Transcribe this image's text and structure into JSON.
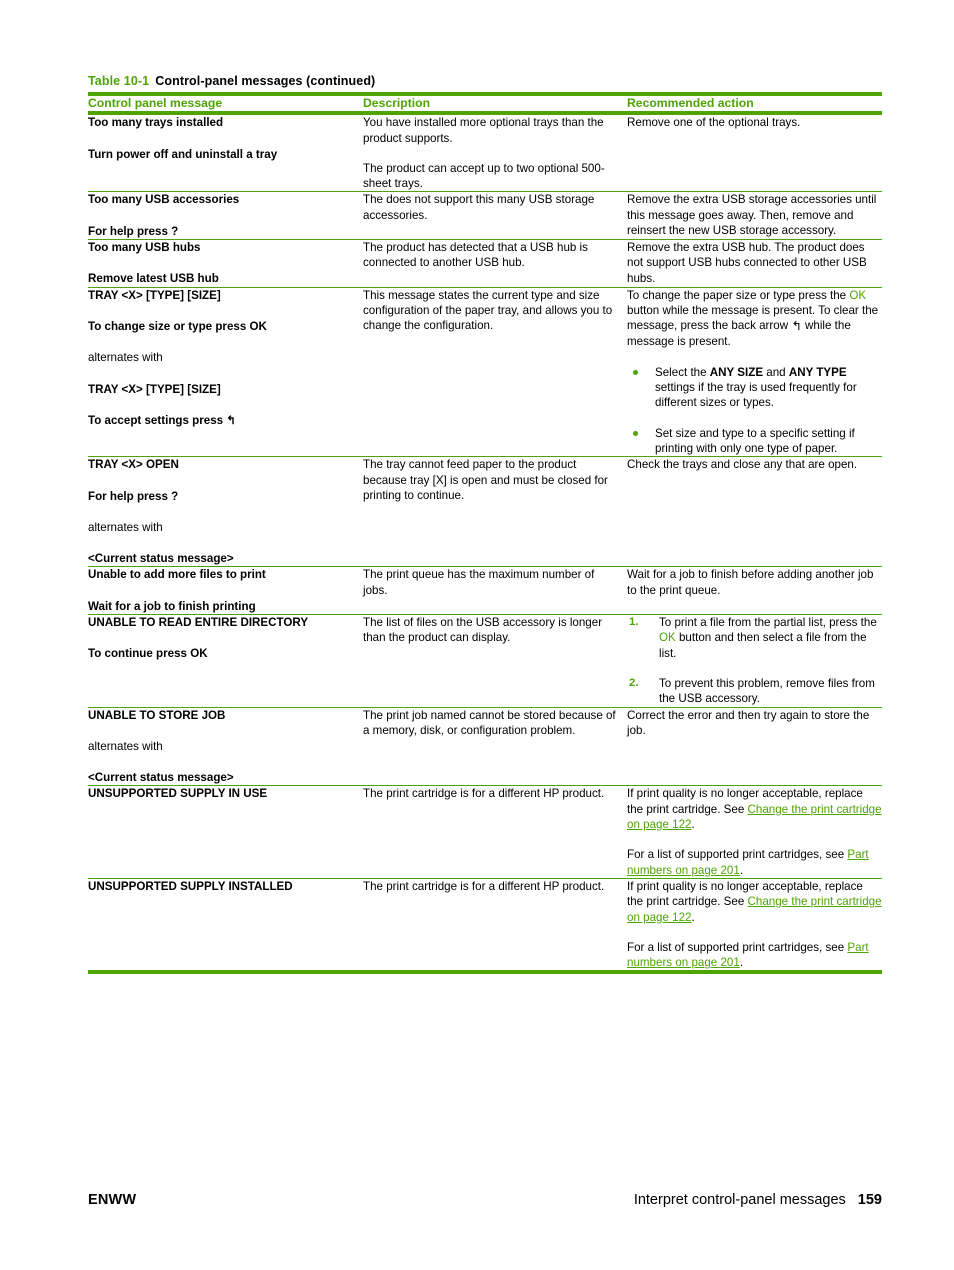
{
  "table": {
    "caption_number": "Table 10-1",
    "caption_title": "Control-panel messages (continued)",
    "headers": {
      "col1": "Control panel message",
      "col2": "Description",
      "col3": "Recommended action"
    },
    "accent_color": "#4ea305",
    "rows": [
      {
        "message_lines": [
          "Too many trays installed",
          "Turn power off and uninstall a tray"
        ],
        "description_paras": [
          "You have installed more optional trays than the product supports.",
          "The product can accept up to two optional 500-sheet trays."
        ],
        "action_paras": [
          "Remove one of the optional trays."
        ]
      },
      {
        "message_lines": [
          "Too many USB accessories",
          "For help press ?"
        ],
        "description_paras": [
          "The does not support this many USB storage accessories."
        ],
        "action_paras": [
          "Remove the extra USB storage accessories until this message goes away. Then, remove and reinsert the new USB storage accessory."
        ]
      },
      {
        "message_lines": [
          "Too many USB hubs",
          "Remove latest USB hub"
        ],
        "description_paras": [
          "The product has detected that a USB hub is connected to another USB hub."
        ],
        "action_paras": [
          "Remove the extra USB hub. The product does not support USB hubs connected to other USB hubs."
        ]
      },
      {
        "message_lines": [
          "TRAY <X> [TYPE] [SIZE]",
          "To change size or type press OK",
          "alternates with",
          "TRAY <X> [TYPE] [SIZE]",
          "To accept settings press ↰"
        ],
        "alternates_label": "alternates with",
        "description_paras": [
          "This message states the current type and size configuration of the paper tray, and allows you to change the configuration."
        ],
        "action_intro_a": "To change the paper size or type press the ",
        "action_ok": "OK",
        "action_intro_b": " button while the message is present. To clear the message, press the back arrow ",
        "action_arrow": "↰",
        "action_intro_c": " while the message is present.",
        "bullets": [
          {
            "a": "Select the ",
            "b1": "ANY SIZE",
            "c": " and ",
            "b2": "ANY TYPE",
            "d": " settings if the tray is used frequently for different sizes or types."
          },
          {
            "a": "Set size and type to a specific setting if printing with only one type of paper.",
            "b1": "",
            "c": "",
            "b2": "",
            "d": ""
          }
        ]
      },
      {
        "message_lines": [
          "TRAY <X> OPEN",
          "For help press ?",
          "alternates with",
          "<Current status message>"
        ],
        "description_paras": [
          "The tray cannot feed paper to the product because tray [X] is open and must be closed for printing to continue."
        ],
        "action_paras": [
          "Check the trays and close any that are open."
        ]
      },
      {
        "message_lines": [
          "Unable to add more files to print",
          "Wait for a job to finish printing"
        ],
        "description_paras": [
          "The print queue has the maximum number of jobs."
        ],
        "action_paras": [
          "Wait for a job to finish before adding another job to the print queue."
        ]
      },
      {
        "message_lines": [
          "UNABLE TO READ ENTIRE DIRECTORY",
          "To continue press OK"
        ],
        "description_paras": [
          "The list of files on the USB accessory is longer than the product can display."
        ],
        "numbered": [
          {
            "a": "To print a file from the partial list, press the ",
            "ok": "OK",
            "b": " button and then select a file from the list."
          },
          {
            "a": "To prevent this problem, remove files from the USB accessory.",
            "ok": "",
            "b": ""
          }
        ]
      },
      {
        "message_lines": [
          "UNABLE TO STORE JOB",
          "alternates with",
          "<Current status message>"
        ],
        "description_paras": [
          "The print job named cannot be stored because of a memory, disk, or configuration problem."
        ],
        "action_paras": [
          "Correct the error and then try again to store the job."
        ]
      },
      {
        "message_lines": [
          "UNSUPPORTED SUPPLY IN USE"
        ],
        "description_paras": [
          "The print cartridge is for a different HP product."
        ],
        "action_rich": {
          "p1_a": "If print quality is no longer acceptable, replace the print cartridge. See ",
          "p1_link": "Change the print cartridge on page 122",
          "p1_b": ".",
          "p2_a": "For a list of supported print cartridges, see ",
          "p2_link": "Part numbers on page 201",
          "p2_b": "."
        }
      },
      {
        "message_lines": [
          "UNSUPPORTED SUPPLY INSTALLED"
        ],
        "description_paras": [
          "The print cartridge is for a different HP product."
        ],
        "action_rich": {
          "p1_a": "If print quality is no longer acceptable, replace the print cartridge. See ",
          "p1_link": "Change the print cartridge on page 122",
          "p1_b": ".",
          "p2_a": "For a list of supported print cartridges, see ",
          "p2_link": "Part numbers on page 201",
          "p2_b": "."
        }
      }
    ]
  },
  "footer": {
    "left": "ENWW",
    "right": "Interpret control-panel messages",
    "page_number": "159"
  }
}
